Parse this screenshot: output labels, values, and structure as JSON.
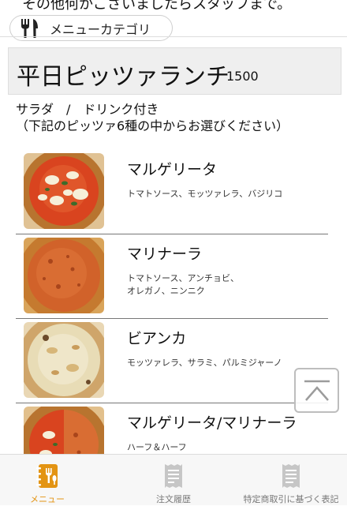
{
  "header": {
    "top_text": "その他何かございましたらスタッフまで。",
    "category_button": {
      "icon": "fork-knife-icon",
      "label": "メニューカテゴリ"
    }
  },
  "section": {
    "title": "平日ピッツァランチ",
    "price": "1500",
    "desc_line1": "サラダ　/　ドリンク付き",
    "desc_line2": "（下記のピッツァ6種の中からお選びください）"
  },
  "items": [
    {
      "name": "マルゲリータ",
      "ingredients_line1": "トマトソース、モッツァレラ、バジリコ",
      "ingredients_line2": ""
    },
    {
      "name": "マリナーラ",
      "ingredients_line1": "トマトソース、アンチョビ、",
      "ingredients_line2": "オレガノ、ニンニク"
    },
    {
      "name": "ビアンカ",
      "ingredients_line1": "モッツァレラ、サラミ、パルミジャーノ",
      "ingredients_line2": ""
    },
    {
      "name": "マルゲリータ/マリナーラ",
      "ingredients_line1": "ハーフ＆ハーフ",
      "ingredients_line2": ""
    }
  ],
  "scroll_top": {
    "icon": "arrow-up-to-top-icon"
  },
  "bottom_nav": [
    {
      "label": "メニュー",
      "icon": "menu-book-icon",
      "active": true
    },
    {
      "label": "注文履歴",
      "icon": "receipt-icon",
      "active": false
    },
    {
      "label": "特定商取引に基づく表記",
      "icon": "document-icon",
      "active": false
    }
  ],
  "colors": {
    "accent": "#e39413",
    "inactive_icon": "#c6c6c6",
    "title_bg": "#efefef"
  }
}
